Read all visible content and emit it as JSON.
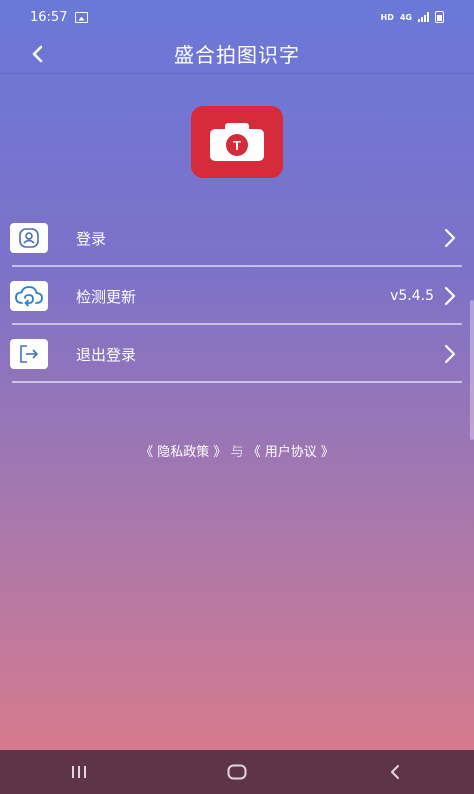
{
  "status_bar": {
    "time": "16:57",
    "network": "HD",
    "signal_type": "4G"
  },
  "header": {
    "title": "盛合拍图识字",
    "back_icon": "chevron-left-icon"
  },
  "logo": {
    "letter": "T",
    "bg_color": "#d52b3b"
  },
  "menu": [
    {
      "label": "登录",
      "icon": "user-icon",
      "value": ""
    },
    {
      "label": "检测更新",
      "icon": "cloud-refresh-icon",
      "value": "v5.4.5"
    },
    {
      "label": "退出登录",
      "icon": "logout-icon",
      "value": ""
    }
  ],
  "policy": {
    "privacy": "《 隐私政策 》",
    "sep": "与",
    "agreement": "《 用户协议 》"
  },
  "nav": {
    "recents": "recents-icon",
    "home": "home-icon",
    "back": "back-icon"
  }
}
